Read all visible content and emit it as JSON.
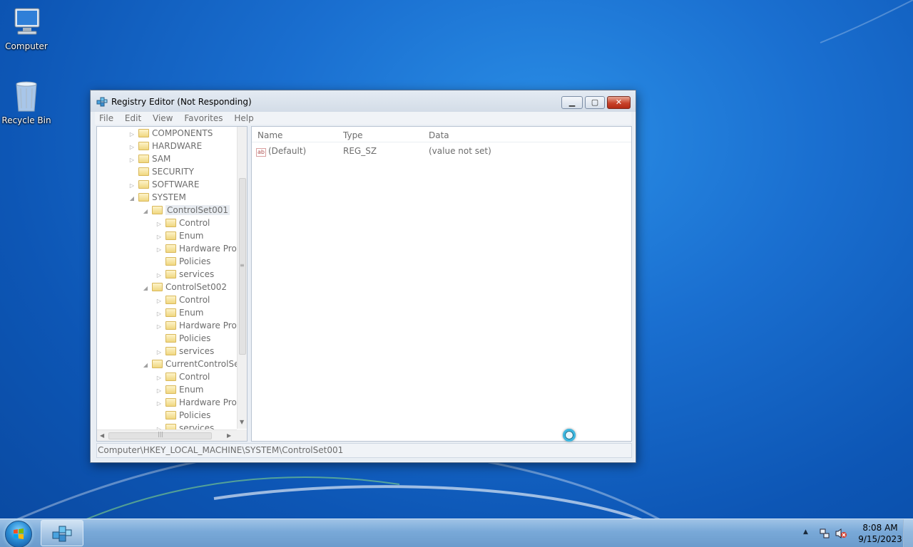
{
  "desktop": {
    "icons": [
      {
        "label": "Computer",
        "icon": "computer-icon"
      },
      {
        "label": "Recycle Bin",
        "icon": "recycle-bin-icon"
      }
    ]
  },
  "window": {
    "title": "Registry Editor (Not Responding)",
    "buttons": {
      "minimize": "minimize-icon",
      "maximize": "maximize-icon",
      "close": "close-icon"
    },
    "menu": [
      "File",
      "Edit",
      "View",
      "Favorites",
      "Help"
    ],
    "tree": [
      {
        "label": "COMPONENTS",
        "expander": "▷"
      },
      {
        "label": "HARDWARE",
        "expander": "▷"
      },
      {
        "label": "SAM",
        "expander": "▷"
      },
      {
        "label": "SECURITY",
        "expander": ""
      },
      {
        "label": "SOFTWARE",
        "expander": "▷"
      },
      {
        "label": "SYSTEM",
        "expander": "◢"
      },
      {
        "label": "ControlSet001",
        "expander": "◢",
        "selected": true
      },
      {
        "label": "Control",
        "expander": "▷"
      },
      {
        "label": "Enum",
        "expander": "▷"
      },
      {
        "label": "Hardware Prof",
        "expander": "▷"
      },
      {
        "label": "Policies",
        "expander": ""
      },
      {
        "label": "services",
        "expander": "▷"
      },
      {
        "label": "ControlSet002",
        "expander": "◢"
      },
      {
        "label": "Control",
        "expander": "▷"
      },
      {
        "label": "Enum",
        "expander": "▷"
      },
      {
        "label": "Hardware Prof",
        "expander": "▷"
      },
      {
        "label": "Policies",
        "expander": ""
      },
      {
        "label": "services",
        "expander": "▷"
      },
      {
        "label": "CurrentControlSet",
        "expander": "◢"
      },
      {
        "label": "Control",
        "expander": "▷"
      },
      {
        "label": "Enum",
        "expander": "▷"
      },
      {
        "label": "Hardware Prof",
        "expander": "▷"
      },
      {
        "label": "Policies",
        "expander": ""
      },
      {
        "label": "services",
        "expander": "▷"
      }
    ],
    "list": {
      "columns": [
        "Name",
        "Type",
        "Data"
      ],
      "rows": [
        {
          "name": "(Default)",
          "type": "REG_SZ",
          "data": "(value not set)",
          "icon": "ab-string-icon"
        }
      ]
    },
    "status": "Computer\\HKEY_LOCAL_MACHINE\\SYSTEM\\ControlSet001"
  },
  "taskbar": {
    "start": "windows-start-icon",
    "tasks": [
      {
        "app": "Registry Editor",
        "icon": "registry-editor-icon"
      }
    ],
    "tray": {
      "time": "8:08 AM",
      "date": "9/15/2023"
    }
  }
}
